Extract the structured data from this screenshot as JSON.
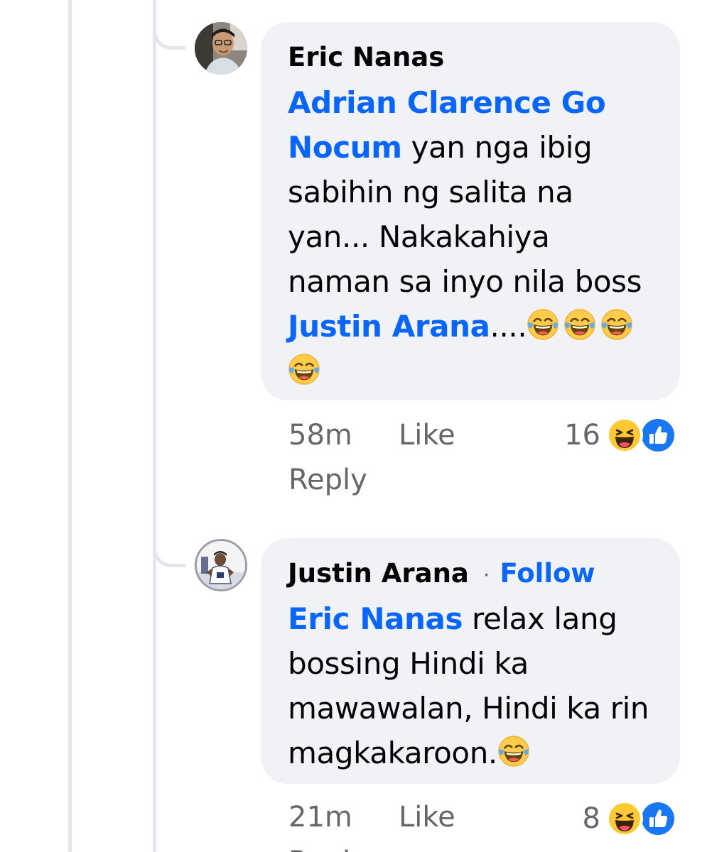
{
  "comments": [
    {
      "author": "Eric Nanas",
      "mention": "Adrian Clarence Go Nocum",
      "text_part1": " yan nga ibig sabihin ng salita na yan... Nakakahiya naman sa inyo nila boss ",
      "mention2": "Justin Arana",
      "text_part2": "....",
      "time": "58m",
      "like_label": "Like",
      "reply_label": "Reply",
      "reaction_count": "16"
    },
    {
      "author": "Justin Arana",
      "separator": "·",
      "follow_label": "Follow",
      "mention": "Eric Nanas",
      "text": " relax lang bossing Hindi ka mawawalan, Hindi ka rin magkakaroon.",
      "time": "21m",
      "like_label": "Like",
      "reply_label": "Reply",
      "reaction_count": "8"
    }
  ],
  "colors": {
    "link": "#0866ff",
    "meta": "#65676b",
    "bubble": "#f0f2f5",
    "thread_line": "#e4e6eb"
  },
  "icons": [
    "laughing-emoji-icon",
    "haha-reaction-icon",
    "like-reaction-icon"
  ]
}
